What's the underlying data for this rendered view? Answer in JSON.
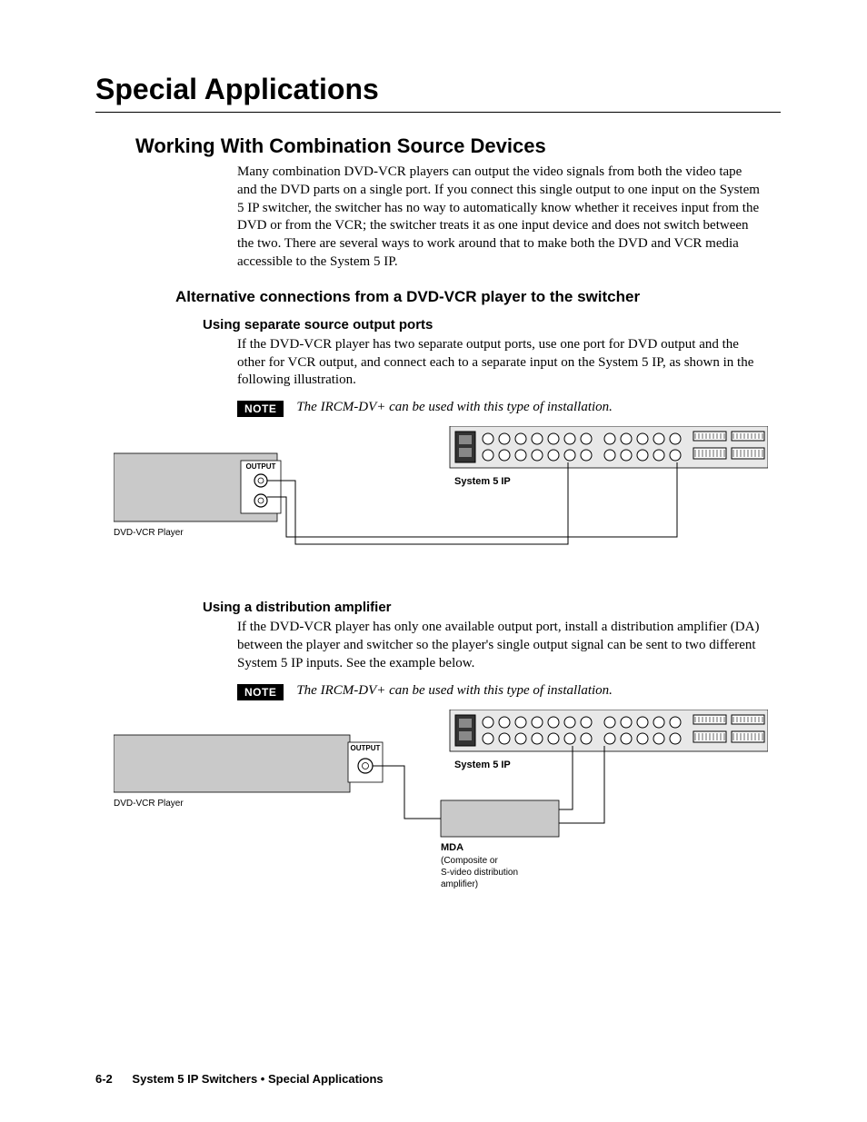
{
  "chapter_title": "Special Applications",
  "section1": {
    "heading": "Working With Combination Source Devices",
    "para1": "Many combination DVD-VCR players can output the video signals from both the video tape and the DVD parts on a single port.  If you connect this single output to one input on the System 5 IP switcher, the switcher has no way to automatically know whether it receives input from the DVD or from the VCR; the switcher treats it as one input device and does not switch between the two.  There are several ways to work around that to make both the DVD and VCR media accessible to the System 5 IP."
  },
  "subsection1": {
    "heading": "Alternative connections from a DVD-VCR player to the switcher"
  },
  "subsub1": {
    "heading": "Using separate source output ports",
    "para1": "If the DVD-VCR player has two separate output ports, use one port for DVD output and the other for VCR output, and connect each to a separate input on the System 5 IP, as shown in the following illustration.",
    "note_label": "NOTE",
    "note_text": "The IRCM-DV+ can be used with this type of installation."
  },
  "figure1": {
    "output_label": "OUTPUT",
    "dvd_label": "DVD-VCR Player",
    "system_label": "System 5 IP"
  },
  "subsub2": {
    "heading": "Using a distribution amplifier",
    "para1": "If the DVD-VCR player has only one available output port, install a distribution amplifier (DA) between the player and switcher so the player's single output signal can be sent to two different System 5 IP inputs.  See the example below.",
    "note_label": "NOTE",
    "note_text": "The IRCM-DV+ can be used with this type of installation."
  },
  "figure2": {
    "output_label": "OUTPUT",
    "dvd_label": "DVD-VCR Player",
    "system_label": "System 5 IP",
    "mda_label": "MDA",
    "mda_desc1": "(Composite or",
    "mda_desc2": "S-video distribution",
    "mda_desc3": "amplifier)"
  },
  "footer": {
    "page_number": "6-2",
    "title": "System 5 IP Switchers • Special Applications"
  }
}
